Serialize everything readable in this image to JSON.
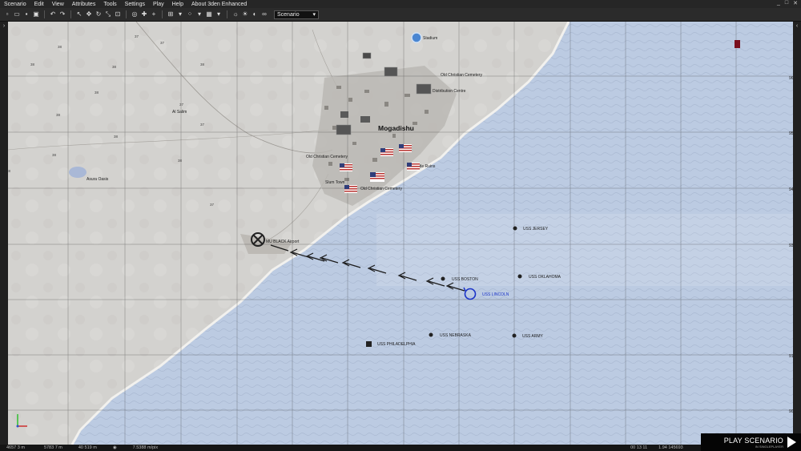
{
  "menu": [
    "Scenario",
    "Edit",
    "View",
    "Attributes",
    "Tools",
    "Settings",
    "Play",
    "Help",
    "About 3den Enhanced"
  ],
  "window_controls": [
    "_",
    "□",
    "✕"
  ],
  "toolbar": {
    "scenario_select": "Scenario"
  },
  "map": {
    "grid_labels_left": [
      "96",
      "95",
      "94",
      "93",
      "93",
      "91",
      "90"
    ],
    "grid_labels_top": [
      "37",
      "38"
    ],
    "elevations": [
      "38",
      "38",
      "37",
      "38",
      "37",
      "38",
      "38",
      "37",
      "38",
      "37",
      "38",
      "38",
      "38",
      "38",
      "37"
    ],
    "town_labels": {
      "stadium": "Stadium",
      "old_cemetery": "Old Christian Cemetery",
      "distribution": "Distribution Centre",
      "mogadishu": "Mogadishu",
      "castle": "Castle Ruins",
      "slum": "Slum Town",
      "christian_cemetery2": "Old Christian Cemetery",
      "cemetery_w": "Old Christian Cemetery",
      "al_salim": "Al Salim",
      "asura": "Asura Oasis",
      "airport": "MU BLACK Airport"
    },
    "ships": {
      "jersey": "USS JERSEY",
      "boston": "USS BOSTON",
      "oklahoma": "USS OKLAHOMA",
      "lincoln": "USS LINCOLN",
      "nebraska": "USS NEBRASKA",
      "army": "USS ARMY",
      "philadelphia": "USS PHILADELPHIA"
    },
    "colors": {
      "land": "#d3d2cf",
      "sea": "#bccbe2",
      "friendly_marker": "#1a33c8",
      "enemy_marker": "#7a0f1e"
    }
  },
  "status": {
    "coord1": "4657 3 m",
    "coord2": "5783 7 m",
    "coord3": "40 519 m",
    "zoom": "7.5388 m/pix",
    "time": "00 13 11",
    "version": "1.94 145693"
  },
  "play": {
    "label": "PLAY SCENARIO",
    "sub": "IN SINGLEPLAYER"
  }
}
